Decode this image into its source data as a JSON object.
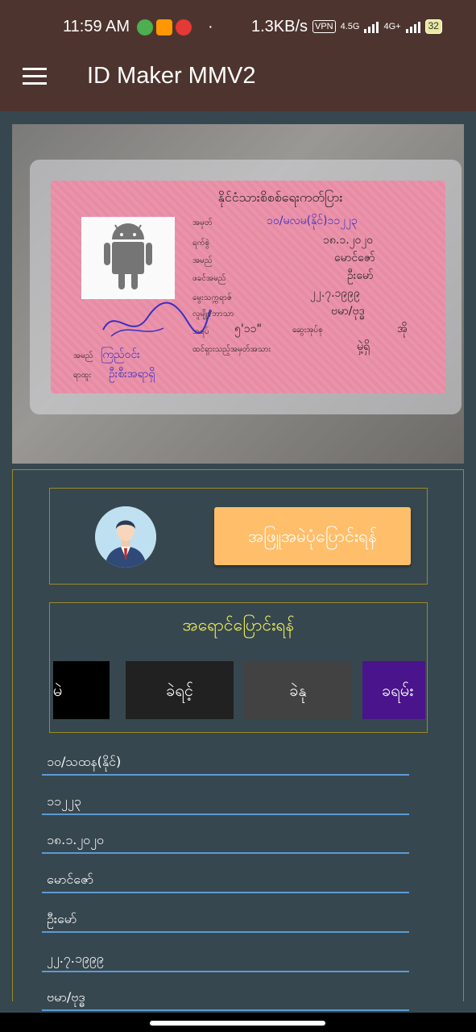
{
  "status_bar": {
    "time": "11:59 AM",
    "dot": "·",
    "net_speed": "1.3KB/s",
    "vpn": "VPN",
    "sig1": "4.5G",
    "sig2": "4G+",
    "battery": "32"
  },
  "app_bar": {
    "title": "ID Maker MMV2",
    "menu_icon": "hamburger-menu-icon"
  },
  "card": {
    "header": "နိုင်ငံသားစိစစ်ရေးကတ်ပြား",
    "labels": [
      "အမှတ်",
      "ရက်စွဲ",
      "အမည်",
      "ဖခင်အမည်",
      "မွေးသက္ကရာဇ်",
      "လူမျိုး/ဘာသာ",
      "အရပ်",
      "ထင်ရှားသည့်အမှတ်အသား"
    ],
    "values": [
      "၁၀/မလမ(နိုင်)၁၁၂၂၃",
      "၁၈.၁.၂၀၂၀",
      "မောင်ဇော်",
      "ဦးမော်",
      "၂၂.၇.၁၉၉၉",
      "ဗမာ/ဗုဒ္ဓ",
      "၅'၁၁\"",
      "မှဲ့ရှိ"
    ],
    "extra": [
      "ဆွေးအုပ်စု",
      "အို"
    ],
    "bottom": [
      "အမည်",
      "ရာထူး"
    ],
    "bottom_vals": [
      "ကြည်ဝင်း",
      "ဦးစီးအရာရှိ"
    ],
    "photo_icon": "android-icon"
  },
  "photo_section": {
    "change_photo_label": "အဖြူအမဲပုံပြောင်းရန်",
    "avatar_icon": "person-avatar-icon"
  },
  "color_section": {
    "heading": "အရောင်ပြောင်းရန်",
    "swatches": [
      {
        "label": "ခမဲ",
        "color": "#000000"
      },
      {
        "label": "ခဲရင့်",
        "color": "#212121"
      },
      {
        "label": "ခဲနု",
        "color": "#424242"
      },
      {
        "label": "ခရမ်း",
        "color": "#4a148c"
      }
    ]
  },
  "fields": [
    "၁၀/သထန(နိုင်)",
    "၁၁၂၂၃",
    "၁၈.၁.၂၀၂၀",
    "မောင်ဇော်",
    "ဦးမော်",
    "၂၂.၇.၁၉၉၉",
    "ဗမာ/ဗုဒ္ဓ"
  ]
}
